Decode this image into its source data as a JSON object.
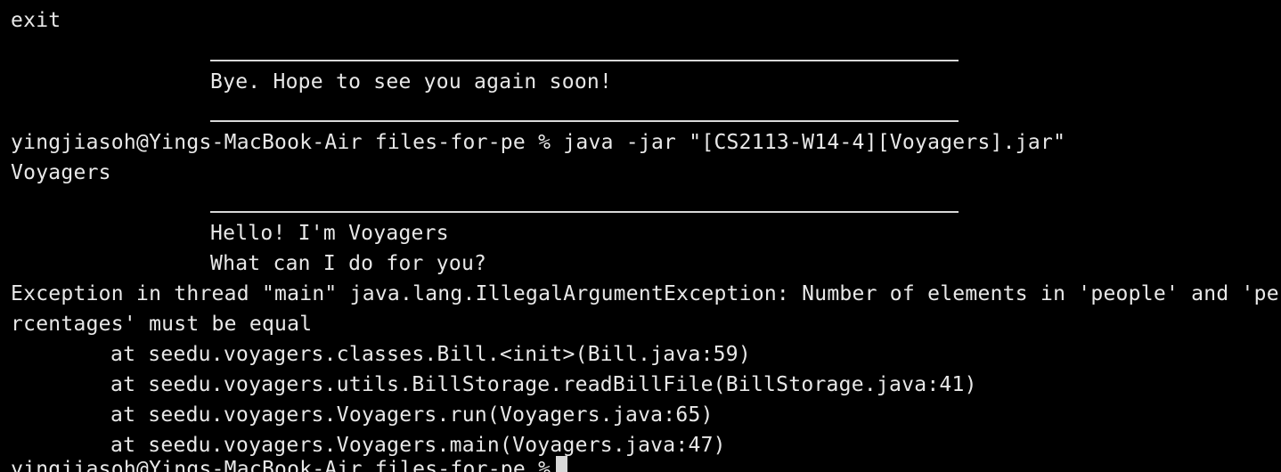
{
  "terminal": {
    "lines": {
      "exit_cmd": "exit",
      "bye": "Bye. Hope to see you again soon!",
      "prompt_run": "yingjiasoh@Yings-MacBook-Air files-for-pe % java -jar \"[CS2113-W14-4][Voyagers].jar\"",
      "app_name": "Voyagers",
      "hello": "Hello! I'm Voyagers",
      "ask": "What can I do for you?",
      "exception_1": "Exception in thread \"main\" java.lang.IllegalArgumentException: Number of elements in 'people' and 'pe",
      "exception_2": "rcentages' must be equal",
      "trace_1": "at seedu.voyagers.classes.Bill.<init>(Bill.java:59)",
      "trace_2": "at seedu.voyagers.utils.BillStorage.readBillFile(BillStorage.java:41)",
      "trace_3": "at seedu.voyagers.Voyagers.run(Voyagers.java:65)",
      "trace_4": "at seedu.voyagers.Voyagers.main(Voyagers.java:47)",
      "prompt_final": "yingjiasoh@Yings-MacBook-Air files-for-pe %"
    },
    "colors": {
      "background": "#000000",
      "text": "#e8e8e8",
      "cursor": "#d8d8d8"
    }
  }
}
